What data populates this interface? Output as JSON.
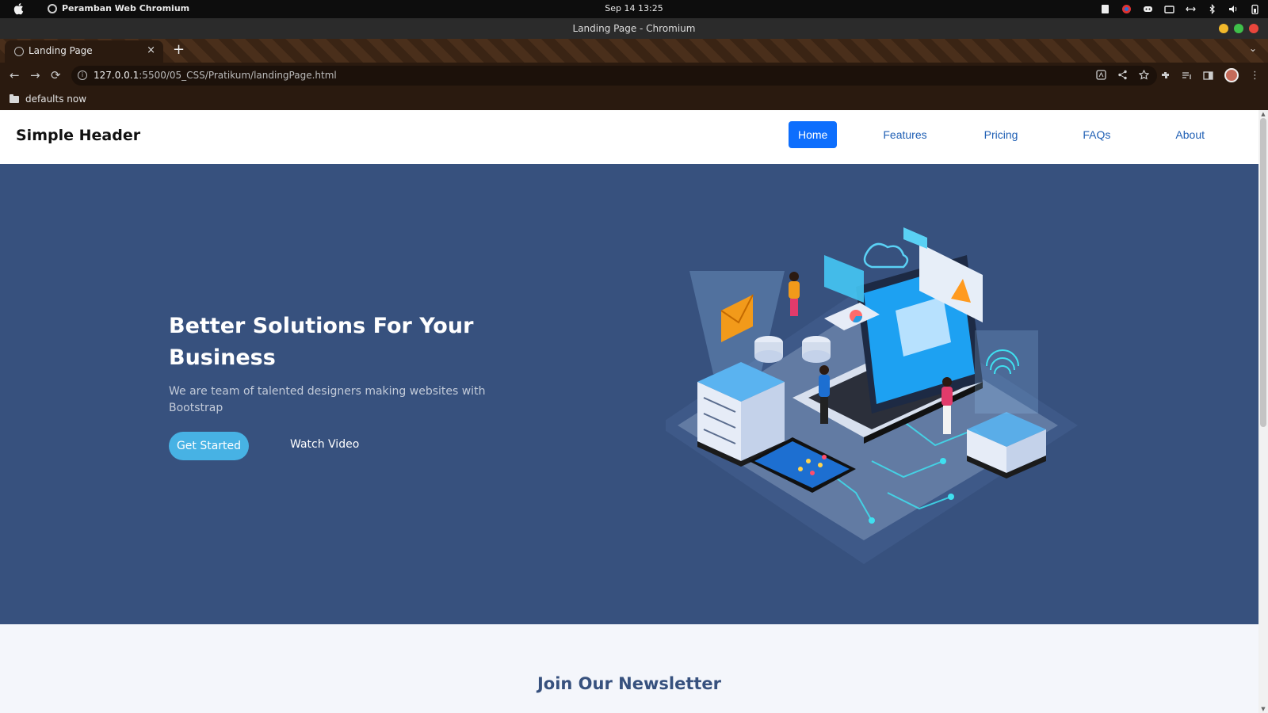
{
  "os": {
    "app_name": "Peramban Web Chromium",
    "datetime": "Sep 14  13:25"
  },
  "window": {
    "title": "Landing Page - Chromium"
  },
  "tabs": [
    {
      "label": "Landing Page",
      "close": "×"
    }
  ],
  "new_tab": "+",
  "tab_menu": "⌄",
  "toolbar": {
    "back": "←",
    "forward": "→",
    "reload": "⟳",
    "url_info": "i",
    "url_host": "127.0.0.1",
    "url_path": ":5500/05_CSS/Pratikum/landingPage.html",
    "menu": "⋮"
  },
  "bookmarks": [
    {
      "label": "defaults now",
      "icon": "folder-icon"
    }
  ],
  "page": {
    "logo": "Simple Header",
    "nav": [
      {
        "label": "Home",
        "active": true
      },
      {
        "label": "Features"
      },
      {
        "label": "Pricing"
      },
      {
        "label": "FAQs"
      },
      {
        "label": "About"
      }
    ],
    "hero": {
      "title": "Better Solutions For Your Business",
      "subtitle": "We are team of talented designers making websites with Bootstrap",
      "primary_button": "Get Started",
      "secondary_button": "Watch Video"
    },
    "newsletter_title": "Join Our Newsletter"
  },
  "colors": {
    "hero_bg": "#37517e",
    "accent": "#47b2e4",
    "nav_active": "#0d6efd",
    "nav_link": "#1f5fb4"
  }
}
